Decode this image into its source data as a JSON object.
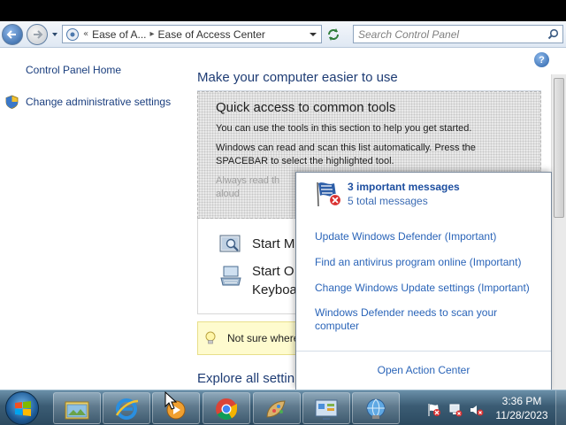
{
  "address_bar": {
    "breadcrumb": [
      "Ease of A...",
      "Ease of Access Center"
    ],
    "search_placeholder": "Search Control Panel"
  },
  "left_pane": {
    "links": [
      "Control Panel Home",
      "Change administrative settings"
    ]
  },
  "main": {
    "title": "Make your computer easier to use",
    "quick_access": {
      "title": "Quick access to common tools",
      "line1": "You can use the tools in this section to help you get started.",
      "line2": "Windows can read and scan this list automatically.  Press the",
      "line3": "SPACEBAR to select the highlighted tool.",
      "checkbox_line1": "Always read th",
      "checkbox_line2": "aloud"
    },
    "tools": {
      "magnifier": "Start M",
      "keyboard_line1": "Start O",
      "keyboard_line2": "Keyboa"
    },
    "tip": "Not sure where",
    "explore": "Explore all settin"
  },
  "action_center": {
    "title": "3 important messages",
    "subtitle": "5 total messages",
    "items": [
      "Update Windows Defender (Important)",
      "Find an antivirus program online (Important)",
      "Change Windows Update settings (Important)",
      "Windows Defender needs to scan your computer"
    ],
    "footer": "Open Action Center"
  },
  "taskbar": {
    "pinned_icons": [
      "explorer-icon",
      "internet-explorer-icon",
      "media-player-icon",
      "chrome-icon",
      "paint-icon",
      "control-panel-icon",
      "network-icon"
    ],
    "tray_icons": [
      "action-center-flag-icon",
      "network-tray-icon",
      "volume-muted-icon"
    ],
    "time": "3:36 PM",
    "date": "11/28/2023"
  },
  "colors": {
    "link_blue": "#1a3e7e",
    "popup_link": "#2a64b8",
    "taskbar": "#3b5c74"
  }
}
